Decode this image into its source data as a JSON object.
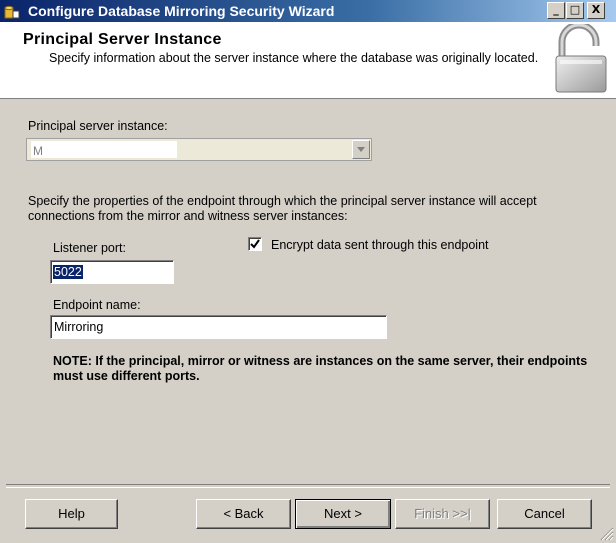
{
  "window": {
    "title": "Configure Database Mirroring Security Wizard",
    "minimize": "_",
    "maximize": "□",
    "close": "X"
  },
  "header": {
    "title": "Principal Server Instance",
    "description": "Specify information about the server instance where the database was originally located.",
    "icon": "padlock-icon"
  },
  "form": {
    "principal_label": "Principal server instance:",
    "principal_value": "M",
    "endpoint_description": "Specify the properties of the endpoint through which the principal server instance will accept connections from the mirror and witness server instances:",
    "listener_port_label": "Listener port:",
    "listener_port_value": "5022",
    "encrypt_label": "Encrypt data sent through this endpoint",
    "encrypt_checked": true,
    "endpoint_name_label": "Endpoint name:",
    "endpoint_name_value": "Mirroring",
    "note": "NOTE: If the principal, mirror or witness are instances on the same server, their endpoints must use different ports."
  },
  "buttons": {
    "help": "Help",
    "back": "< Back",
    "next": "Next >",
    "finish": "Finish >>|",
    "cancel": "Cancel"
  },
  "colors": {
    "titlebar_start": "#0a246a",
    "titlebar_end": "#a6caf0",
    "dialog_bg": "#d4d0c8",
    "selection": "#0a246a"
  }
}
